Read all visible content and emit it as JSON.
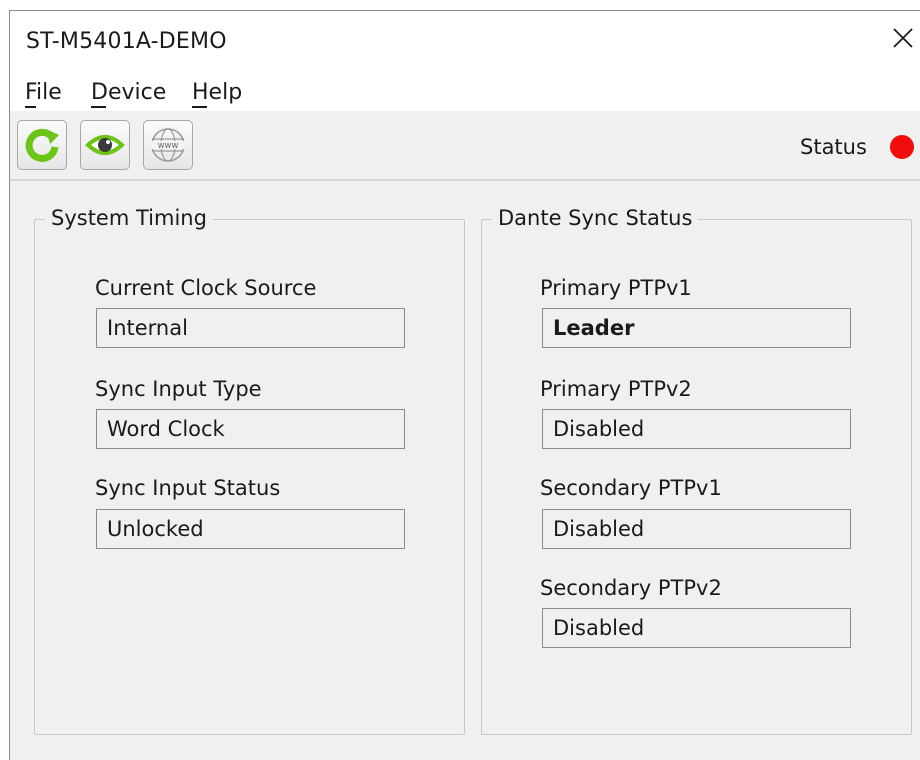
{
  "window": {
    "title": "ST-M5401A-DEMO"
  },
  "menu": {
    "file": "File",
    "device": "Device",
    "help": "Help"
  },
  "toolbar": {
    "refresh_icon": "refresh-icon",
    "monitor_icon": "eye-icon",
    "web_icon": "www-icon",
    "web_label": "www",
    "status_label": "Status",
    "status_color": "#f20d0d"
  },
  "system_timing": {
    "title": "System Timing",
    "fields": [
      {
        "label": "Current Clock Source",
        "value": "Internal"
      },
      {
        "label": "Sync Input Type",
        "value": "Word Clock"
      },
      {
        "label": "Sync Input Status",
        "value": "Unlocked"
      }
    ]
  },
  "dante_sync": {
    "title": "Dante Sync Status",
    "fields": [
      {
        "label": "Primary PTPv1",
        "value": "Leader"
      },
      {
        "label": "Primary PTPv2",
        "value": "Disabled"
      },
      {
        "label": "Secondary PTPv1",
        "value": "Disabled"
      },
      {
        "label": "Secondary PTPv2",
        "value": "Disabled"
      }
    ]
  }
}
